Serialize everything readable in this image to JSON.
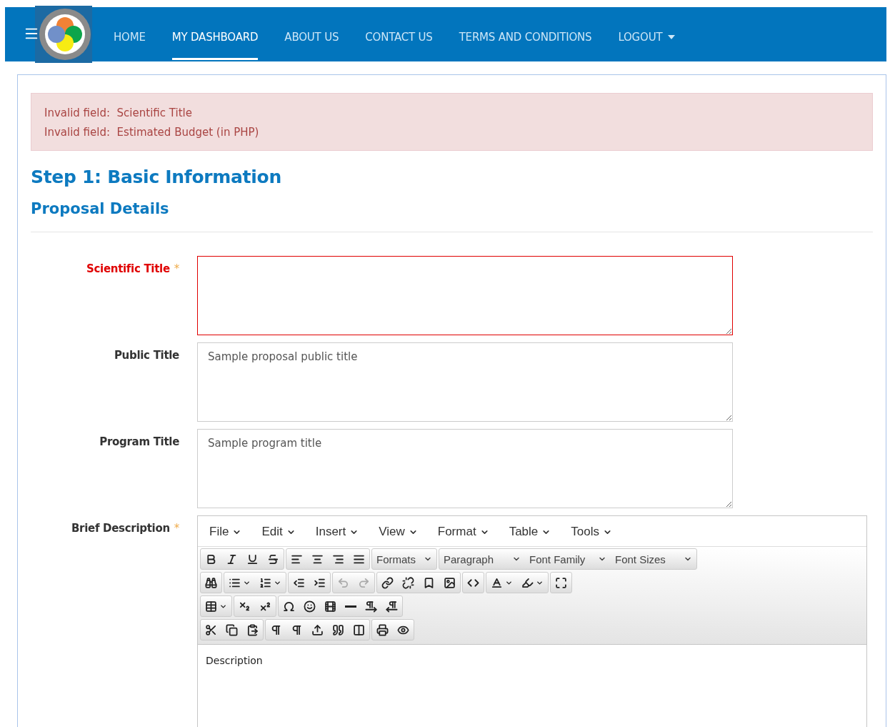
{
  "nav": {
    "items": [
      {
        "label": "HOME",
        "selected": false,
        "dropdown": false
      },
      {
        "label": "MY DASHBOARD",
        "selected": true,
        "dropdown": false
      },
      {
        "label": "ABOUT US",
        "selected": false,
        "dropdown": false
      },
      {
        "label": "CONTACT US",
        "selected": false,
        "dropdown": false
      },
      {
        "label": "TERMS AND CONDITIONS",
        "selected": false,
        "dropdown": false
      },
      {
        "label": "LOGOUT",
        "selected": false,
        "dropdown": true
      }
    ]
  },
  "alert": {
    "messages": [
      {
        "prefix": "Invalid field:",
        "field": "Scientific Title"
      },
      {
        "prefix": "Invalid field:",
        "field": "Estimated Budget (in PHP)"
      }
    ]
  },
  "heading": "Step 1: Basic Information",
  "subheading": "Proposal Details",
  "required_mark": "*",
  "fields": [
    {
      "label": "Scientific Title",
      "required": true,
      "invalid": true
    },
    {
      "label": "Public Title",
      "required": false,
      "invalid": false,
      "value": "Sample proposal public title"
    },
    {
      "label": "Program Title",
      "required": false,
      "invalid": false,
      "value": "Sample program title"
    }
  ],
  "editor": {
    "label": "Brief Description",
    "required": true,
    "menu": [
      "File",
      "Edit",
      "Insert",
      "View",
      "Format",
      "Table",
      "Tools"
    ],
    "toolbar_rows": [
      [
        [
          {
            "kind": "icon",
            "disabled": false
          },
          {
            "kind": "icon",
            "disabled": false
          },
          {
            "kind": "icon",
            "disabled": false
          },
          {
            "kind": "icon",
            "disabled": false
          }
        ],
        [
          {
            "kind": "icon",
            "disabled": false
          },
          {
            "kind": "icon",
            "disabled": false
          },
          {
            "kind": "icon",
            "disabled": false
          },
          {
            "kind": "icon",
            "disabled": false
          }
        ],
        [
          {
            "kind": "select",
            "label": "Formats"
          }
        ],
        [
          {
            "kind": "select",
            "label": "Paragraph"
          },
          {
            "kind": "select",
            "label": "Font Family"
          },
          {
            "kind": "select",
            "label": "Font Sizes"
          }
        ]
      ],
      [
        [
          {
            "kind": "icon",
            "disabled": false
          }
        ],
        [
          {
            "kind": "split",
            "disabled": false
          },
          {
            "kind": "split",
            "disabled": false
          }
        ],
        [
          {
            "kind": "icon",
            "disabled": false
          },
          {
            "kind": "icon",
            "disabled": false
          }
        ],
        [
          {
            "kind": "icon",
            "disabled": true
          },
          {
            "kind": "icon",
            "disabled": true
          }
        ],
        [
          {
            "kind": "icon",
            "disabled": false
          },
          {
            "kind": "icon",
            "disabled": false
          },
          {
            "kind": "icon",
            "disabled": false
          },
          {
            "kind": "icon",
            "disabled": false
          }
        ],
        [
          {
            "kind": "icon",
            "disabled": false
          }
        ],
        [
          {
            "kind": "split",
            "disabled": false
          },
          {
            "kind": "split",
            "disabled": false
          }
        ],
        [
          {
            "kind": "icon",
            "disabled": false
          }
        ]
      ],
      [
        [
          {
            "kind": "split",
            "disabled": false
          }
        ],
        [
          {
            "kind": "icon",
            "disabled": false
          },
          {
            "kind": "icon",
            "disabled": false
          }
        ],
        [
          {
            "kind": "icon",
            "disabled": false
          },
          {
            "kind": "icon",
            "disabled": false
          },
          {
            "kind": "icon",
            "disabled": false
          },
          {
            "kind": "icon",
            "disabled": false
          },
          {
            "kind": "icon",
            "disabled": false
          },
          {
            "kind": "icon",
            "disabled": false
          }
        ]
      ],
      [
        [
          {
            "kind": "icon",
            "disabled": false
          },
          {
            "kind": "icon",
            "disabled": false
          },
          {
            "kind": "icon",
            "disabled": false
          }
        ],
        [
          {
            "kind": "icon",
            "disabled": false
          },
          {
            "kind": "icon",
            "disabled": false
          },
          {
            "kind": "icon",
            "disabled": false
          },
          {
            "kind": "icon",
            "disabled": false
          },
          {
            "kind": "icon",
            "disabled": false
          }
        ],
        [
          {
            "kind": "icon",
            "disabled": false
          },
          {
            "kind": "icon",
            "disabled": false
          }
        ]
      ]
    ],
    "content": "Description"
  }
}
